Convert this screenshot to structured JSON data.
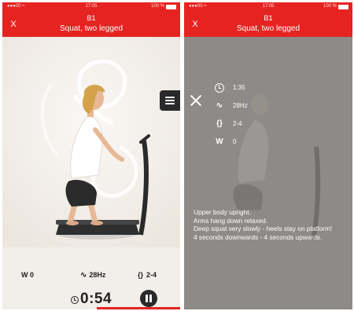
{
  "left_screen": {
    "status": {
      "carrier": "●●●00 ≈",
      "time": "17:05",
      "battery": "100 %"
    },
    "header": {
      "close": "X",
      "exercise_number": "B1",
      "exercise_title": "Squat, two legged"
    },
    "stats": {
      "weight": "W 0",
      "frequency": "28Hz",
      "amplitude": "2-4"
    },
    "timer": "0:54",
    "colors": {
      "header": "#e52421",
      "background": "#f2eeea",
      "dark_button": "#2a2a2a"
    }
  },
  "right_screen": {
    "status": {
      "carrier": "●●●00 ≈",
      "time": "17:05",
      "battery": "100 %"
    },
    "header": {
      "close": "X",
      "exercise_number": "B1",
      "exercise_title": "Squat, two legged"
    },
    "info": {
      "duration": "1:35",
      "frequency": "28Hz",
      "amplitude": "2-4",
      "weight_icon": "W",
      "weight": "0"
    },
    "instructions": [
      "Upper body upright.",
      "Arms hang down relaxed.",
      "Deep squat very slowly - heels stay on platform!",
      "4 seconds downwards - 4 seconds upwards."
    ],
    "colors": {
      "overlay": "#8d8a88"
    }
  }
}
